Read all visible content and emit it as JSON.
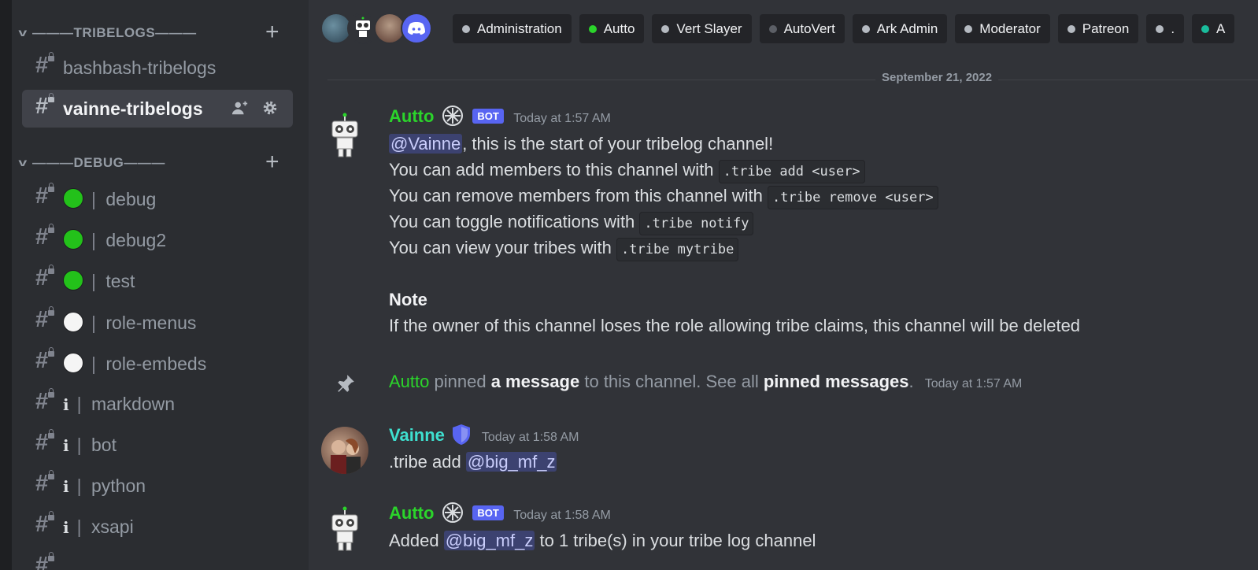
{
  "sidebar": {
    "categories": [
      {
        "title": "———TRIBELOGS———"
      },
      {
        "title": "———DEBUG———"
      }
    ],
    "tribelog_channels": [
      {
        "name": "bashbash-tribelogs"
      },
      {
        "name": "vainne-tribelogs"
      }
    ],
    "debug_channels": [
      {
        "prefix": "green",
        "name": "debug"
      },
      {
        "prefix": "green",
        "name": "debug2"
      },
      {
        "prefix": "green",
        "name": "test"
      },
      {
        "prefix": "white",
        "name": "role-menus"
      },
      {
        "prefix": "white",
        "name": "role-embeds"
      },
      {
        "prefix": "i",
        "name": "markdown"
      },
      {
        "prefix": "i",
        "name": "bot"
      },
      {
        "prefix": "i",
        "name": "python"
      },
      {
        "prefix": "i",
        "name": "xsapi"
      }
    ],
    "separator": "|",
    "info_glyph": "i"
  },
  "roles": [
    {
      "name": "Administration",
      "color": "#b5bac1"
    },
    {
      "name": "Autto",
      "color": "#2bd42b"
    },
    {
      "name": "Vert Slayer",
      "color": "#b5bac1"
    },
    {
      "name": "AutoVert",
      "color": "#5c5f66"
    },
    {
      "name": "Ark Admin",
      "color": "#b5bac1"
    },
    {
      "name": "Moderator",
      "color": "#b5bac1"
    },
    {
      "name": "Patreon",
      "color": "#b5bac1"
    },
    {
      "name": ".",
      "color": "#b5bac1"
    },
    {
      "name": "A",
      "color": "#1abc9c"
    }
  ],
  "date_divider": "September 21, 2022",
  "messages": {
    "m1": {
      "author": "Autto",
      "author_color": "#2bd42b",
      "bot_badge": "BOT",
      "time": "Today at 1:57 AM",
      "mention": "@Vainne",
      "l1_rest": ", this is the start of your tribelog channel!",
      "l2_text": "You can add members to this channel with",
      "l2_code": ".tribe add <user>",
      "l3_text": "You can remove members from this channel with",
      "l3_code": ".tribe remove <user>",
      "l4_text": "You can toggle notifications with",
      "l4_code": ".tribe notify",
      "l5_text": "You can view your tribes with",
      "l5_code": ".tribe mytribe",
      "note_title": "Note",
      "note_text": "If the owner of this channel loses the role allowing tribe claims, this channel will be deleted"
    },
    "pin": {
      "author": "Autto",
      "t1": "pinned",
      "link1": "a message",
      "t2": "to this channel. See all",
      "link2": "pinned messages",
      "t3": ".",
      "time": "Today at 1:57 AM"
    },
    "m2": {
      "author": "Vainne",
      "author_color": "#3ee0d0",
      "time": "Today at 1:58 AM",
      "text": ".tribe add",
      "mention": "@big_mf_z"
    },
    "m3": {
      "author": "Autto",
      "bot_badge": "BOT",
      "time": "Today at 1:58 AM",
      "text1": "Added",
      "mention": "@big_mf_z",
      "text2": "to 1 tribe(s) in your tribe log channel"
    }
  },
  "colors": {
    "green_status": "#23c11a",
    "blurple": "#5865f2"
  }
}
